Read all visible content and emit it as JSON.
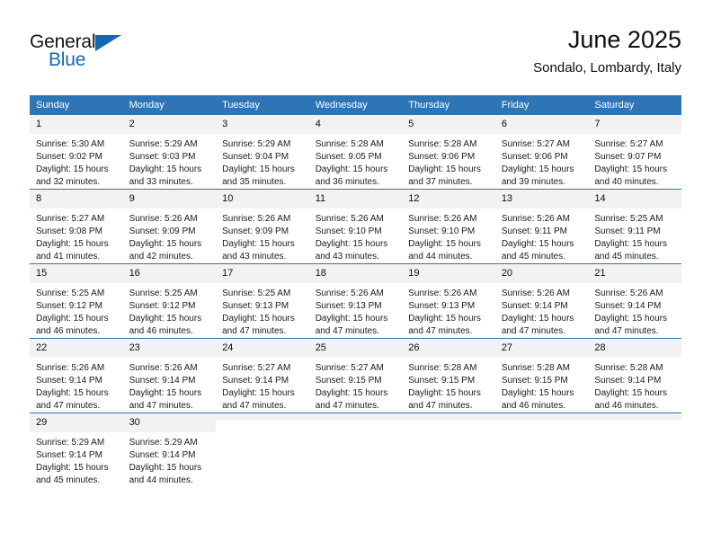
{
  "brand": {
    "name_part1": "General",
    "name_part2": "Blue",
    "triangle_color": "#1569b4"
  },
  "header": {
    "title": "June 2025",
    "subtitle": "Sondalo, Lombardy, Italy",
    "accent_color": "#2e75b6",
    "daynum_band_color": "#f2f2f2"
  },
  "weekdays": [
    "Sunday",
    "Monday",
    "Tuesday",
    "Wednesday",
    "Thursday",
    "Friday",
    "Saturday"
  ],
  "labels": {
    "sunrise_prefix": "Sunrise:",
    "sunset_prefix": "Sunset:",
    "daylight_prefix": "Daylight:"
  },
  "weeks": [
    [
      {
        "day": "1",
        "sunrise": "Sunrise: 5:30 AM",
        "sunset": "Sunset: 9:02 PM",
        "daylight_line1": "Daylight: 15 hours",
        "daylight_line2": "and 32 minutes."
      },
      {
        "day": "2",
        "sunrise": "Sunrise: 5:29 AM",
        "sunset": "Sunset: 9:03 PM",
        "daylight_line1": "Daylight: 15 hours",
        "daylight_line2": "and 33 minutes."
      },
      {
        "day": "3",
        "sunrise": "Sunrise: 5:29 AM",
        "sunset": "Sunset: 9:04 PM",
        "daylight_line1": "Daylight: 15 hours",
        "daylight_line2": "and 35 minutes."
      },
      {
        "day": "4",
        "sunrise": "Sunrise: 5:28 AM",
        "sunset": "Sunset: 9:05 PM",
        "daylight_line1": "Daylight: 15 hours",
        "daylight_line2": "and 36 minutes."
      },
      {
        "day": "5",
        "sunrise": "Sunrise: 5:28 AM",
        "sunset": "Sunset: 9:06 PM",
        "daylight_line1": "Daylight: 15 hours",
        "daylight_line2": "and 37 minutes."
      },
      {
        "day": "6",
        "sunrise": "Sunrise: 5:27 AM",
        "sunset": "Sunset: 9:06 PM",
        "daylight_line1": "Daylight: 15 hours",
        "daylight_line2": "and 39 minutes."
      },
      {
        "day": "7",
        "sunrise": "Sunrise: 5:27 AM",
        "sunset": "Sunset: 9:07 PM",
        "daylight_line1": "Daylight: 15 hours",
        "daylight_line2": "and 40 minutes."
      }
    ],
    [
      {
        "day": "8",
        "sunrise": "Sunrise: 5:27 AM",
        "sunset": "Sunset: 9:08 PM",
        "daylight_line1": "Daylight: 15 hours",
        "daylight_line2": "and 41 minutes."
      },
      {
        "day": "9",
        "sunrise": "Sunrise: 5:26 AM",
        "sunset": "Sunset: 9:09 PM",
        "daylight_line1": "Daylight: 15 hours",
        "daylight_line2": "and 42 minutes."
      },
      {
        "day": "10",
        "sunrise": "Sunrise: 5:26 AM",
        "sunset": "Sunset: 9:09 PM",
        "daylight_line1": "Daylight: 15 hours",
        "daylight_line2": "and 43 minutes."
      },
      {
        "day": "11",
        "sunrise": "Sunrise: 5:26 AM",
        "sunset": "Sunset: 9:10 PM",
        "daylight_line1": "Daylight: 15 hours",
        "daylight_line2": "and 43 minutes."
      },
      {
        "day": "12",
        "sunrise": "Sunrise: 5:26 AM",
        "sunset": "Sunset: 9:10 PM",
        "daylight_line1": "Daylight: 15 hours",
        "daylight_line2": "and 44 minutes."
      },
      {
        "day": "13",
        "sunrise": "Sunrise: 5:26 AM",
        "sunset": "Sunset: 9:11 PM",
        "daylight_line1": "Daylight: 15 hours",
        "daylight_line2": "and 45 minutes."
      },
      {
        "day": "14",
        "sunrise": "Sunrise: 5:25 AM",
        "sunset": "Sunset: 9:11 PM",
        "daylight_line1": "Daylight: 15 hours",
        "daylight_line2": "and 45 minutes."
      }
    ],
    [
      {
        "day": "15",
        "sunrise": "Sunrise: 5:25 AM",
        "sunset": "Sunset: 9:12 PM",
        "daylight_line1": "Daylight: 15 hours",
        "daylight_line2": "and 46 minutes."
      },
      {
        "day": "16",
        "sunrise": "Sunrise: 5:25 AM",
        "sunset": "Sunset: 9:12 PM",
        "daylight_line1": "Daylight: 15 hours",
        "daylight_line2": "and 46 minutes."
      },
      {
        "day": "17",
        "sunrise": "Sunrise: 5:25 AM",
        "sunset": "Sunset: 9:13 PM",
        "daylight_line1": "Daylight: 15 hours",
        "daylight_line2": "and 47 minutes."
      },
      {
        "day": "18",
        "sunrise": "Sunrise: 5:26 AM",
        "sunset": "Sunset: 9:13 PM",
        "daylight_line1": "Daylight: 15 hours",
        "daylight_line2": "and 47 minutes."
      },
      {
        "day": "19",
        "sunrise": "Sunrise: 5:26 AM",
        "sunset": "Sunset: 9:13 PM",
        "daylight_line1": "Daylight: 15 hours",
        "daylight_line2": "and 47 minutes."
      },
      {
        "day": "20",
        "sunrise": "Sunrise: 5:26 AM",
        "sunset": "Sunset: 9:14 PM",
        "daylight_line1": "Daylight: 15 hours",
        "daylight_line2": "and 47 minutes."
      },
      {
        "day": "21",
        "sunrise": "Sunrise: 5:26 AM",
        "sunset": "Sunset: 9:14 PM",
        "daylight_line1": "Daylight: 15 hours",
        "daylight_line2": "and 47 minutes."
      }
    ],
    [
      {
        "day": "22",
        "sunrise": "Sunrise: 5:26 AM",
        "sunset": "Sunset: 9:14 PM",
        "daylight_line1": "Daylight: 15 hours",
        "daylight_line2": "and 47 minutes."
      },
      {
        "day": "23",
        "sunrise": "Sunrise: 5:26 AM",
        "sunset": "Sunset: 9:14 PM",
        "daylight_line1": "Daylight: 15 hours",
        "daylight_line2": "and 47 minutes."
      },
      {
        "day": "24",
        "sunrise": "Sunrise: 5:27 AM",
        "sunset": "Sunset: 9:14 PM",
        "daylight_line1": "Daylight: 15 hours",
        "daylight_line2": "and 47 minutes."
      },
      {
        "day": "25",
        "sunrise": "Sunrise: 5:27 AM",
        "sunset": "Sunset: 9:15 PM",
        "daylight_line1": "Daylight: 15 hours",
        "daylight_line2": "and 47 minutes."
      },
      {
        "day": "26",
        "sunrise": "Sunrise: 5:28 AM",
        "sunset": "Sunset: 9:15 PM",
        "daylight_line1": "Daylight: 15 hours",
        "daylight_line2": "and 47 minutes."
      },
      {
        "day": "27",
        "sunrise": "Sunrise: 5:28 AM",
        "sunset": "Sunset: 9:15 PM",
        "daylight_line1": "Daylight: 15 hours",
        "daylight_line2": "and 46 minutes."
      },
      {
        "day": "28",
        "sunrise": "Sunrise: 5:28 AM",
        "sunset": "Sunset: 9:14 PM",
        "daylight_line1": "Daylight: 15 hours",
        "daylight_line2": "and 46 minutes."
      }
    ],
    [
      {
        "day": "29",
        "sunrise": "Sunrise: 5:29 AM",
        "sunset": "Sunset: 9:14 PM",
        "daylight_line1": "Daylight: 15 hours",
        "daylight_line2": "and 45 minutes."
      },
      {
        "day": "30",
        "sunrise": "Sunrise: 5:29 AM",
        "sunset": "Sunset: 9:14 PM",
        "daylight_line1": "Daylight: 15 hours",
        "daylight_line2": "and 44 minutes."
      },
      {
        "day": "",
        "sunrise": "",
        "sunset": "",
        "daylight_line1": "",
        "daylight_line2": ""
      },
      {
        "day": "",
        "sunrise": "",
        "sunset": "",
        "daylight_line1": "",
        "daylight_line2": ""
      },
      {
        "day": "",
        "sunrise": "",
        "sunset": "",
        "daylight_line1": "",
        "daylight_line2": ""
      },
      {
        "day": "",
        "sunrise": "",
        "sunset": "",
        "daylight_line1": "",
        "daylight_line2": ""
      },
      {
        "day": "",
        "sunrise": "",
        "sunset": "",
        "daylight_line1": "",
        "daylight_line2": ""
      }
    ]
  ]
}
